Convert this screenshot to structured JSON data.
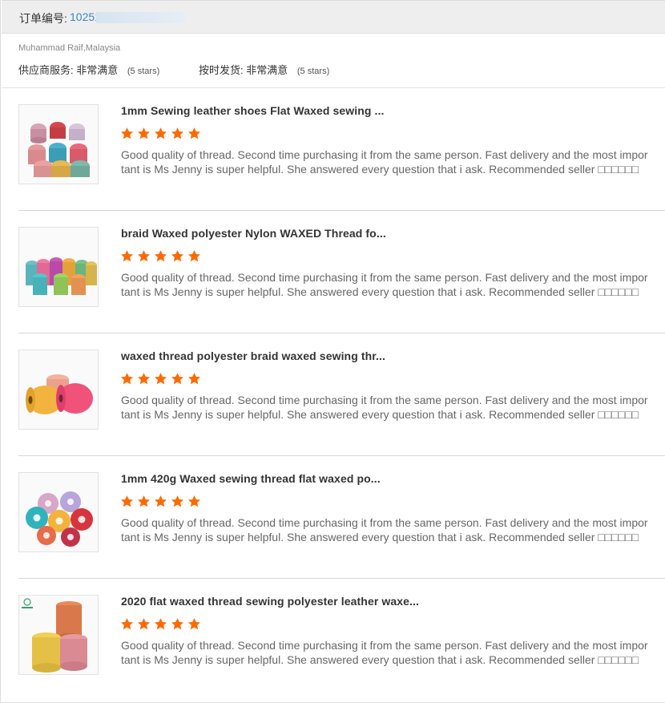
{
  "order": {
    "label": "订单编号:",
    "number": "10251"
  },
  "buyer": {
    "name": "Muhammad Raif,Malaysia",
    "ratings": [
      {
        "label": "供应商服务:",
        "value": "非常满意",
        "stars": "(5 stars)"
      },
      {
        "label": "按时发货:",
        "value": "非常满意",
        "stars": "(5 stars)"
      }
    ]
  },
  "colors": {
    "star": "#ff6a00",
    "order_number": "#3a86c8"
  },
  "reviews": [
    {
      "title": "1mm Sewing leather shoes Flat Waxed sewing ...",
      "rating": 5,
      "text": "Good quality of thread. Second time purchasing it from the same person. Fast delivery and the most important is Ms Jenny is super helpful. She answered every question that i ask. Recommended seller □□□□□□",
      "image": "thread-spools-image"
    },
    {
      "title": "braid Waxed polyester Nylon WAXED Thread fo...",
      "rating": 5,
      "text": "Good quality of thread. Second time purchasing it from the same person. Fast delivery and the most important is Ms Jenny is super helpful. She answered every question that i ask. Recommended seller □□□□□□",
      "image": "thread-spools-image"
    },
    {
      "title": "waxed thread polyester braid waxed sewing thr...",
      "rating": 5,
      "text": "Good quality of thread. Second time purchasing it from the same person. Fast delivery and the most important is Ms Jenny is super helpful. She answered every question that i ask. Recommended seller □□□□□□",
      "image": "thread-spools-image"
    },
    {
      "title": "1mm 420g Waxed sewing thread flat waxed po...",
      "rating": 5,
      "text": "Good quality of thread. Second time purchasing it from the same person. Fast delivery and the most important is Ms Jenny is super helpful. She answered every question that i ask. Recommended seller □□□□□□",
      "image": "thread-spools-image"
    },
    {
      "title": "2020 flat waxed thread sewing polyester leather waxe...",
      "rating": 5,
      "text": "Good quality of thread. Second time purchasing it from the same person. Fast delivery and the most important is Ms Jenny is super helpful. She answered every question that i ask. Recommended seller □□□□□□",
      "image": "thread-spools-image"
    }
  ]
}
